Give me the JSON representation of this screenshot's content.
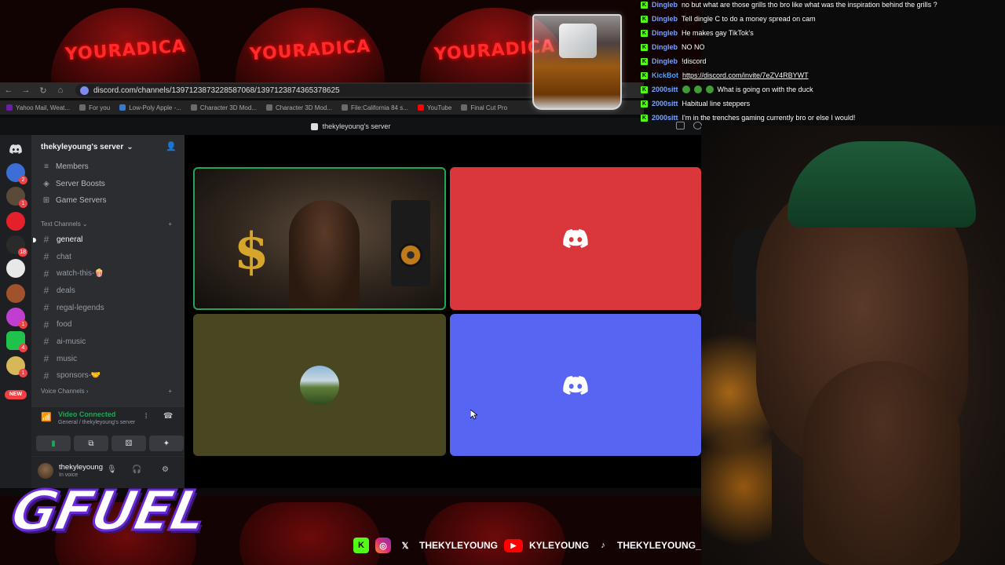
{
  "overlay": {
    "cap_text": "YOURADICA",
    "gfuel_text": "GFUEL"
  },
  "browser": {
    "url": "discord.com/channels/1397123873228587068/1397123874365378625",
    "bookmarks": [
      "Yahoo Mail, Weat...",
      "For you",
      "Low-Poly Apple -...",
      "Character 3D Mod...",
      "Character 3D Mod...",
      "File:California 84 s...",
      "YouTube",
      "Final Cut Pro"
    ]
  },
  "window": {
    "title": "thekyleyoung's server"
  },
  "guild_rail": {
    "badges": [
      "2",
      "1",
      "18",
      "1",
      "4",
      "1"
    ],
    "new_label": "NEW"
  },
  "sidebar": {
    "server_name": "thekyleyoung's server",
    "links": [
      {
        "icon": "members-icon",
        "label": "Members"
      },
      {
        "icon": "boost-icon",
        "label": "Server Boosts"
      },
      {
        "icon": "controller-icon",
        "label": "Game Servers"
      }
    ],
    "text_category": "Text Channels",
    "channels": [
      "general",
      "chat",
      "watch-this-🍿",
      "deals",
      "regal-legends",
      "food",
      "ai-music",
      "music",
      "sponsors-🤝"
    ],
    "voice_category": "Voice Channels"
  },
  "voice_panel": {
    "status": "Video Connected",
    "location": "General / thekyleyoung's server"
  },
  "user_panel": {
    "username": "thekyleyoung",
    "status": "In voice"
  },
  "chat": [
    {
      "user": "Dingleb",
      "text": "no but what are those grills tho bro like what was the inspiration behind the grills ?"
    },
    {
      "user": "Dingleb",
      "text": "Tell dingle C to do a money spread on cam"
    },
    {
      "user": "Dingleb",
      "text": "He makes gay TikTok's"
    },
    {
      "user": "Dingleb",
      "text": "NO NO"
    },
    {
      "user": "Dingleb",
      "text": "!discord"
    },
    {
      "user": "KickBot",
      "text": "https://discord.com/invite/7eZV4RBYWT"
    },
    {
      "user": "2000sitt",
      "text": "What is going on with the duck"
    },
    {
      "user": "2000sitt",
      "text": "Habitual line steppers"
    },
    {
      "user": "2000sitt",
      "text": "I'm in the trenches gaming currently bro or else I would!"
    }
  ],
  "socials": {
    "x_handle": "THEKYLEYOUNG",
    "youtube_handle": "KYLEYOUNG",
    "tiktok_handle": "THEKYLEYOUNG_"
  },
  "colors": {
    "discord_red_tile": "#da373c",
    "discord_blurple_tile": "#5865f2",
    "olive_tile": "#494722",
    "voice_green": "#23a55a",
    "kick_green": "#53fc18"
  }
}
